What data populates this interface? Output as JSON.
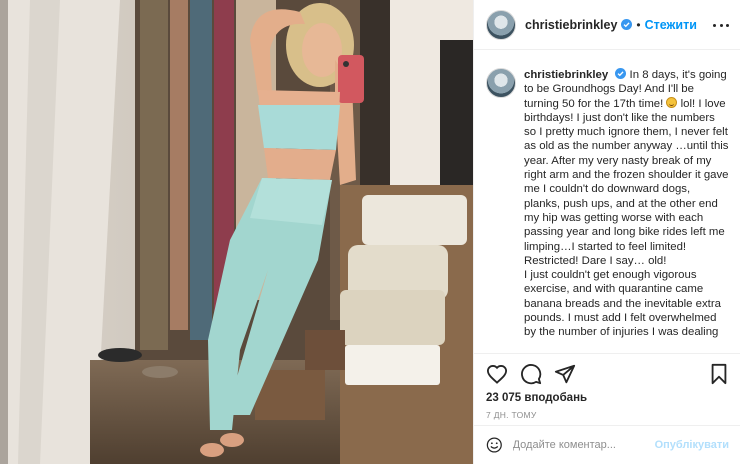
{
  "post": {
    "image_alt": "Mirror selfie in closet",
    "header": {
      "username": "christiebrinkley",
      "separator": "•",
      "follow_label": "Стежити"
    },
    "caption": {
      "username": "christiebrinkley",
      "text_part1": "In 8 days, it's going to be Groundhogs Day! And I'll be turning 50 for the 17th time!",
      "text_part2": "lol! I love birthdays! I just don't like the numbers so I pretty much ignore them, I never felt as old as the number anyway …until this year. After my very nasty break of my right arm and the frozen shoulder it gave me I couldn't do downward dogs, planks, push ups, and at the other end my hip was getting worse with each passing year and long bike rides left me limping…I started to feel limited! Restricted! Dare I say… old!",
      "text_part3": "I just couldn't get enough vigorous exercise, and with quarantine came banana breads and the inevitable extra pounds. I must add I felt overwhelmed by the number of injuries I was dealing"
    },
    "likes": "23 075 вподобань",
    "timestamp": "7 ДН. ТОМУ",
    "comment": {
      "placeholder": "Додайте коментар...",
      "publish_label": "Опублікувати"
    },
    "colors": {
      "link": "#0095f6",
      "publish_disabled": "#b2dffc",
      "verified": "#3897f0"
    },
    "icons": [
      "more-icon",
      "verified-icon",
      "heart-icon",
      "comment-icon",
      "share-icon",
      "bookmark-icon",
      "emoji-icon"
    ]
  }
}
